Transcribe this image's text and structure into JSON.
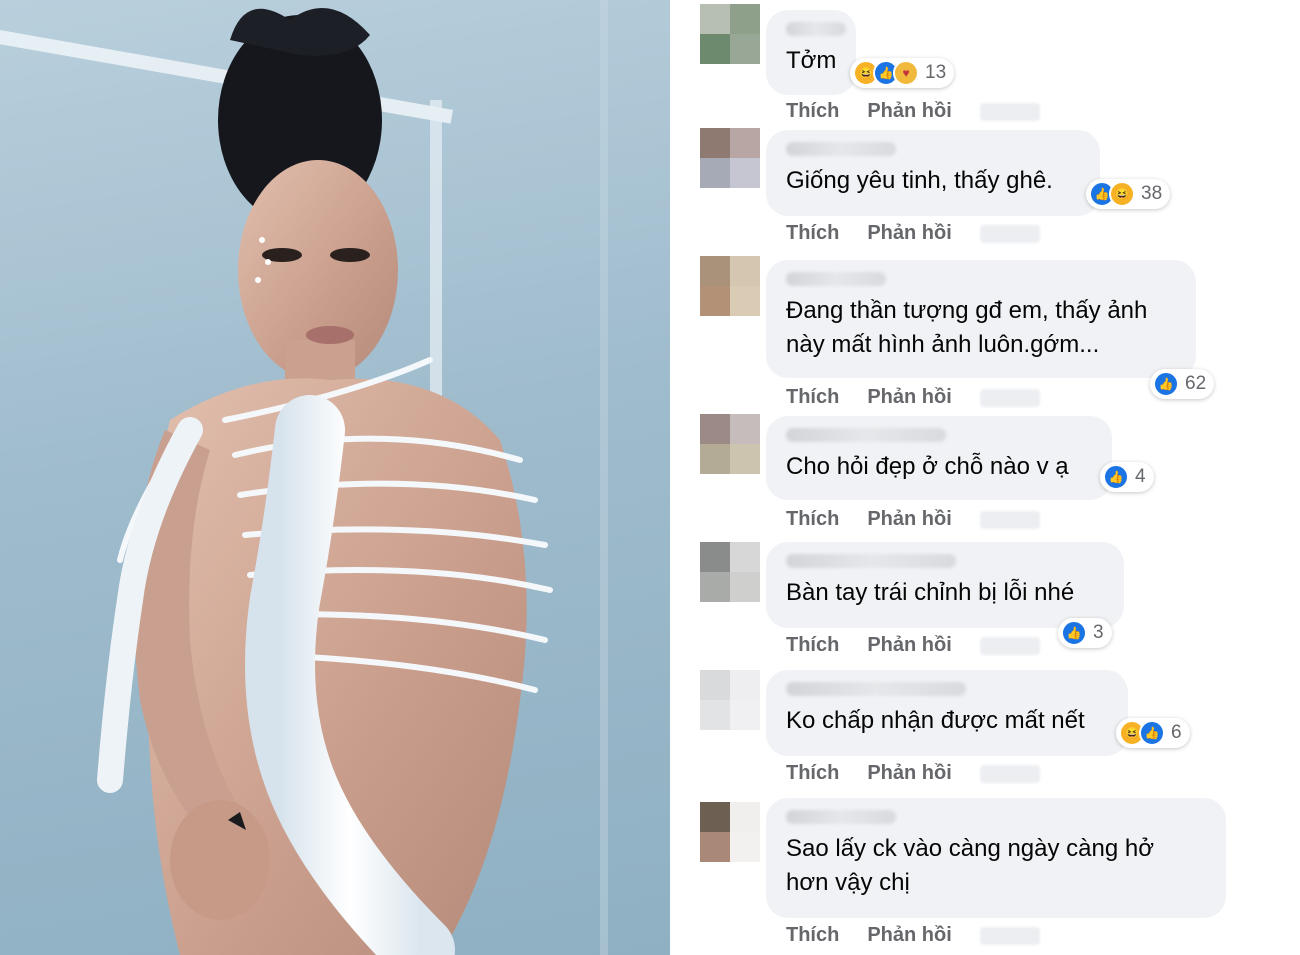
{
  "photo": {
    "alt": ""
  },
  "actions": {
    "like": "Thích",
    "reply": "Phản hồi"
  },
  "comments": [
    {
      "text": "Tởm",
      "reactions": [
        "haha-icon",
        "like-icon",
        "care-icon"
      ],
      "count": "13",
      "avatar_colors": [
        "#b6bfb1",
        "#8fa08a",
        "#6d8a6f",
        "#99a896"
      ]
    },
    {
      "text": "Giống yêu tinh, thấy ghê.",
      "reactions": [
        "like-icon",
        "haha-icon"
      ],
      "count": "38",
      "avatar_colors": [
        "#8e7a71",
        "#b8a6a4",
        "#a6a9b6",
        "#c5c6d2"
      ]
    },
    {
      "text_lines": [
        "Đang thần tượng gđ em, thấy ảnh",
        "này mất hình ảnh luôn.gớm..."
      ],
      "reactions": [
        "like-icon"
      ],
      "count": "62",
      "avatar_colors": [
        "#a9917a",
        "#d4c6b0",
        "#b39176",
        "#d9cbb4"
      ]
    },
    {
      "text": "Cho hỏi đẹp ở chỗ nào v ạ",
      "reactions": [
        "like-icon"
      ],
      "count": "4",
      "avatar_colors": [
        "#9c8a87",
        "#c7bcbc",
        "#b3ab95",
        "#cdc4b0"
      ]
    },
    {
      "text": "Bàn tay trái chỉnh bị lỗi nhé",
      "reactions": [
        "like-icon"
      ],
      "count": "3",
      "avatar_colors": [
        "#8a8c8c",
        "#d6d7d6",
        "#a8aba7",
        "#cfd0cd"
      ]
    },
    {
      "text": "Ko chấp nhận được mất nết",
      "reactions": [
        "haha-icon",
        "like-icon"
      ],
      "count": "6",
      "avatar_colors": [
        "#d9dadc",
        "#eeeef0",
        "#e2e3e5",
        "#f0f0f2"
      ]
    },
    {
      "text_lines": [
        "Sao lấy ck vào càng ngày càng hở",
        "hơn vậy chị"
      ],
      "reactions": [],
      "count": "",
      "avatar_colors": [
        "#6d5f52",
        "#f0efee",
        "#a98878",
        "#f2f1f0"
      ]
    }
  ]
}
